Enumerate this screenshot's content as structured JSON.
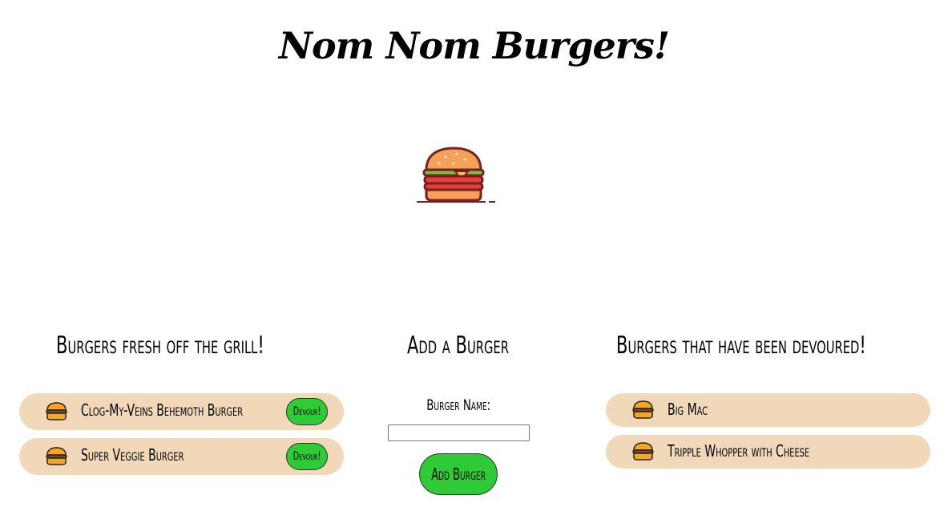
{
  "site": {
    "title": "Nom Nom Burgers!"
  },
  "logo": {
    "icon": "hamburger-logo-icon"
  },
  "fresh": {
    "heading": "Burgers fresh off the grill!",
    "devour_label": "Devour!",
    "items": [
      {
        "name": "Clog-My-Veins Behemoth Burger",
        "icon": "burger-icon"
      },
      {
        "name": "Super Veggie Burger",
        "icon": "burger-icon"
      }
    ]
  },
  "add_form": {
    "heading": "Add a Burger",
    "label": "Burger Name:",
    "input_value": "",
    "submit_label": "Add Burger"
  },
  "devoured": {
    "heading": "Burgers that have been devoured!",
    "items": [
      {
        "name": "Big Mac",
        "icon": "burger-icon"
      },
      {
        "name": "Tripple Whopper with Cheese",
        "icon": "burger-icon"
      }
    ]
  },
  "colors": {
    "item_background": "#f1d8b8",
    "button_green": "#2ecb36"
  }
}
